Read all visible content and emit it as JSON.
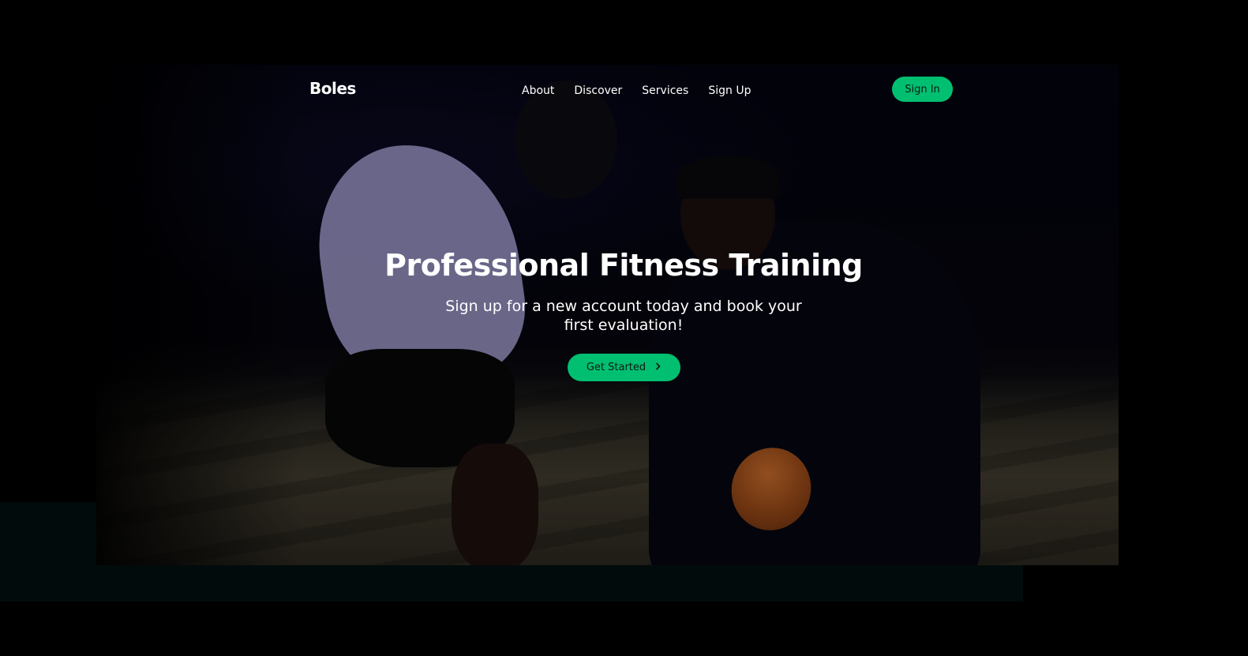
{
  "nav": {
    "logo": "Boles",
    "links": [
      {
        "label": "About"
      },
      {
        "label": "Discover"
      },
      {
        "label": "Services"
      },
      {
        "label": "Sign Up"
      }
    ],
    "signin_label": "Sign In"
  },
  "hero": {
    "title": "Professional Fitness Training",
    "subtitle": "Sign up for a new account today and book your first evaluation!",
    "cta_label": "Get Started",
    "cta_icon": "chevron-right-icon"
  },
  "colors": {
    "accent": "#01bf71",
    "background": "#000000",
    "section_dark": "#020b0b"
  }
}
